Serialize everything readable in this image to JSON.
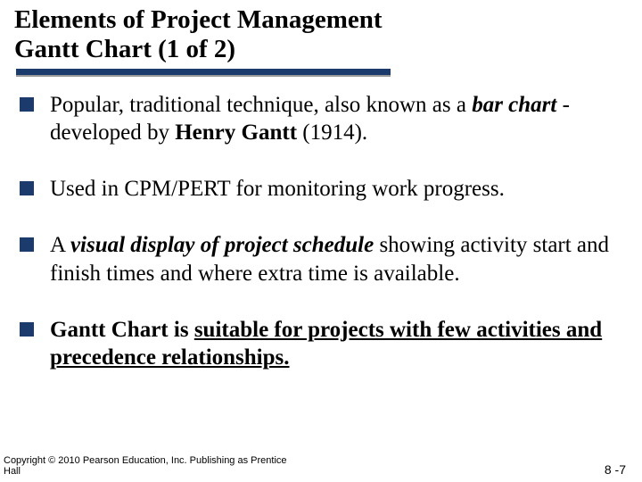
{
  "title": {
    "line1": "Elements of Project Management",
    "line2": "Gantt Chart  (1 of 2)"
  },
  "bullets": {
    "b1": {
      "p1": "Popular, traditional technique, also known as a ",
      "p2": "bar chart",
      "p3": "  -developed by ",
      "p4": "Henry Gantt",
      "p5": " (1914)."
    },
    "b2": "Used in CPM/PERT for monitoring work progress.",
    "b3": {
      "p1": "A ",
      "p2": "visual display of project schedule",
      "p3": " showing activity start and finish times and where extra time is available."
    },
    "b4": {
      "p1": "Gantt Chart is ",
      "p2": "suitable for projects with few activities and precedence relationships."
    }
  },
  "footer": {
    "copyright_l1": "Copyright © 2010 Pearson Education, Inc. Publishing as Prentice",
    "copyright_l2": "Hall",
    "pagenum": "8 -7"
  }
}
